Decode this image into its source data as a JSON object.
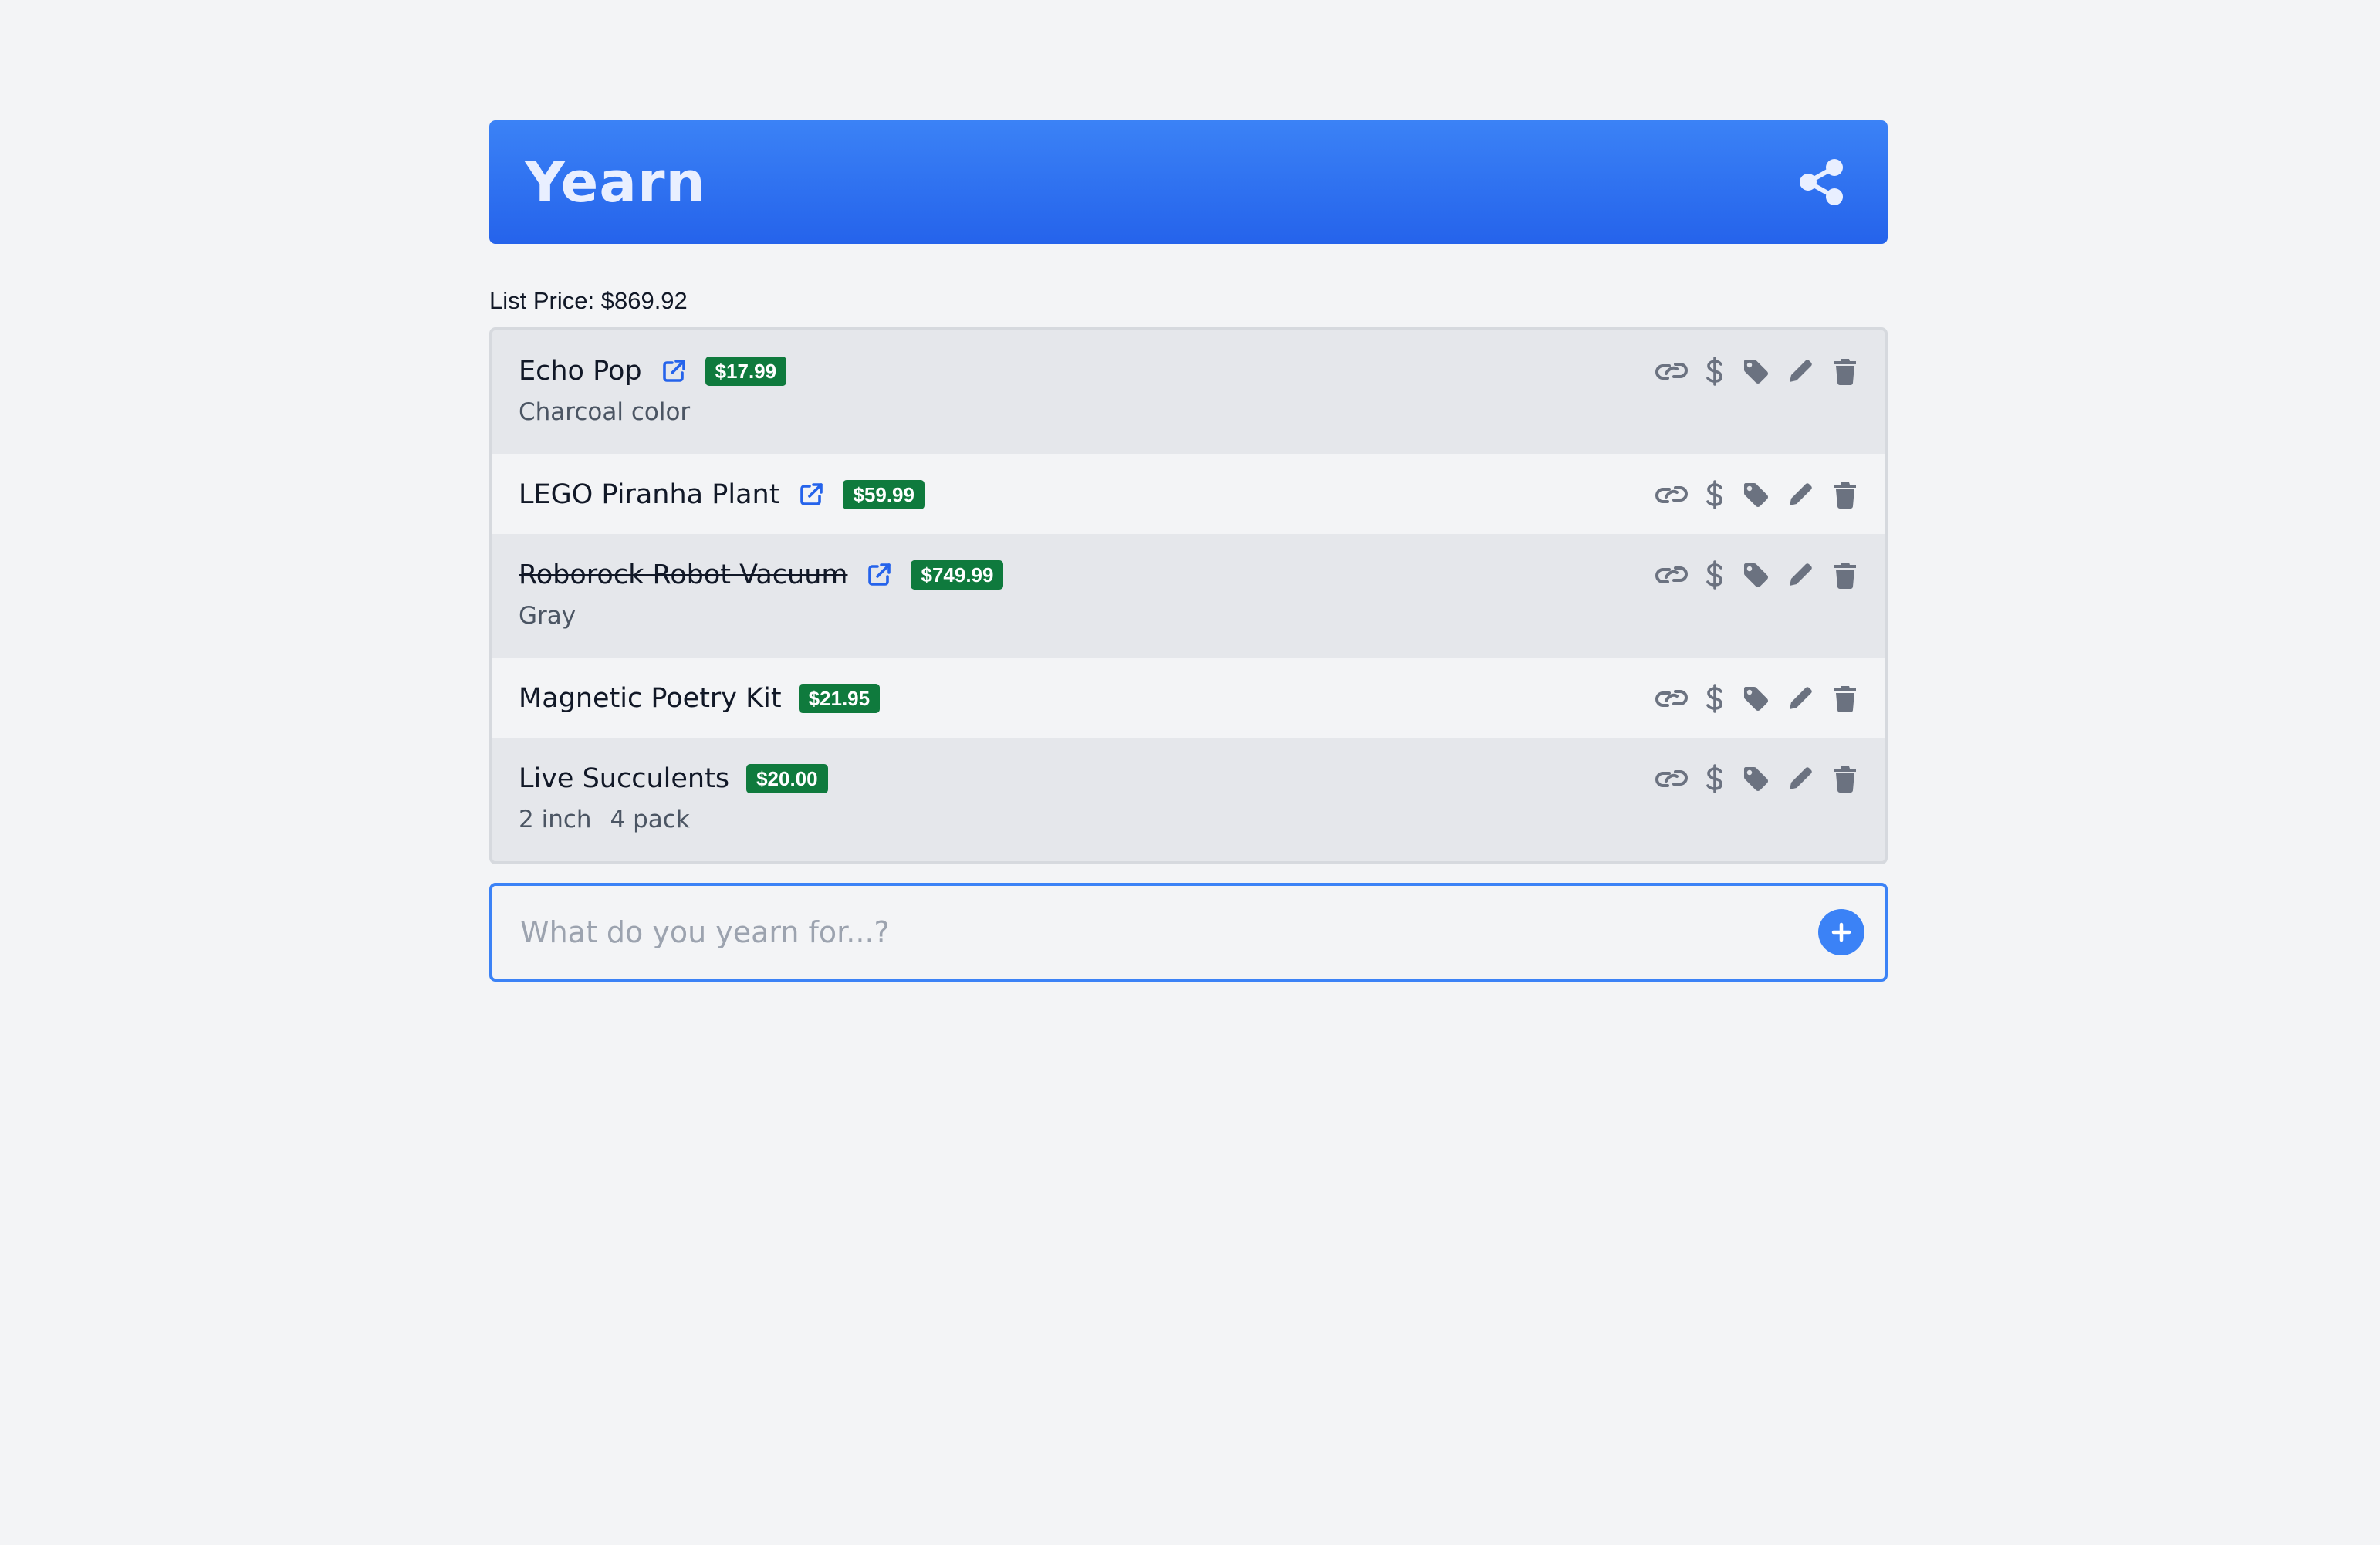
{
  "app": {
    "title": "Yearn",
    "accent_color": "#2563eb",
    "share_icon": "share-icon"
  },
  "summary": {
    "list_price_label": "List Price:",
    "list_price_value": "$869.92"
  },
  "items": [
    {
      "title": "Echo Pop",
      "has_link": true,
      "struck": false,
      "price": "$17.99",
      "details": [
        "Charcoal color"
      ]
    },
    {
      "title": "LEGO Piranha Plant",
      "has_link": true,
      "struck": false,
      "price": "$59.99",
      "details": []
    },
    {
      "title": "Roborock Robot Vacuum",
      "has_link": true,
      "struck": true,
      "price": "$749.99",
      "details": [
        "Gray"
      ]
    },
    {
      "title": "Magnetic Poetry Kit",
      "has_link": false,
      "struck": false,
      "price": "$21.95",
      "details": []
    },
    {
      "title": "Live Succulents",
      "has_link": false,
      "struck": false,
      "price": "$20.00",
      "details": [
        "2 inch",
        "4 pack"
      ]
    }
  ],
  "item_actions": [
    "link-icon",
    "dollar-icon",
    "tag-icon",
    "pencil-icon",
    "trash-icon"
  ],
  "add_form": {
    "placeholder": "What do you yearn for...?",
    "value": "",
    "add_icon": "plus-circle-icon"
  },
  "colors": {
    "price_badge": "#0f7a3d",
    "link_blue": "#2563eb",
    "action_gray": "#6b7280"
  }
}
